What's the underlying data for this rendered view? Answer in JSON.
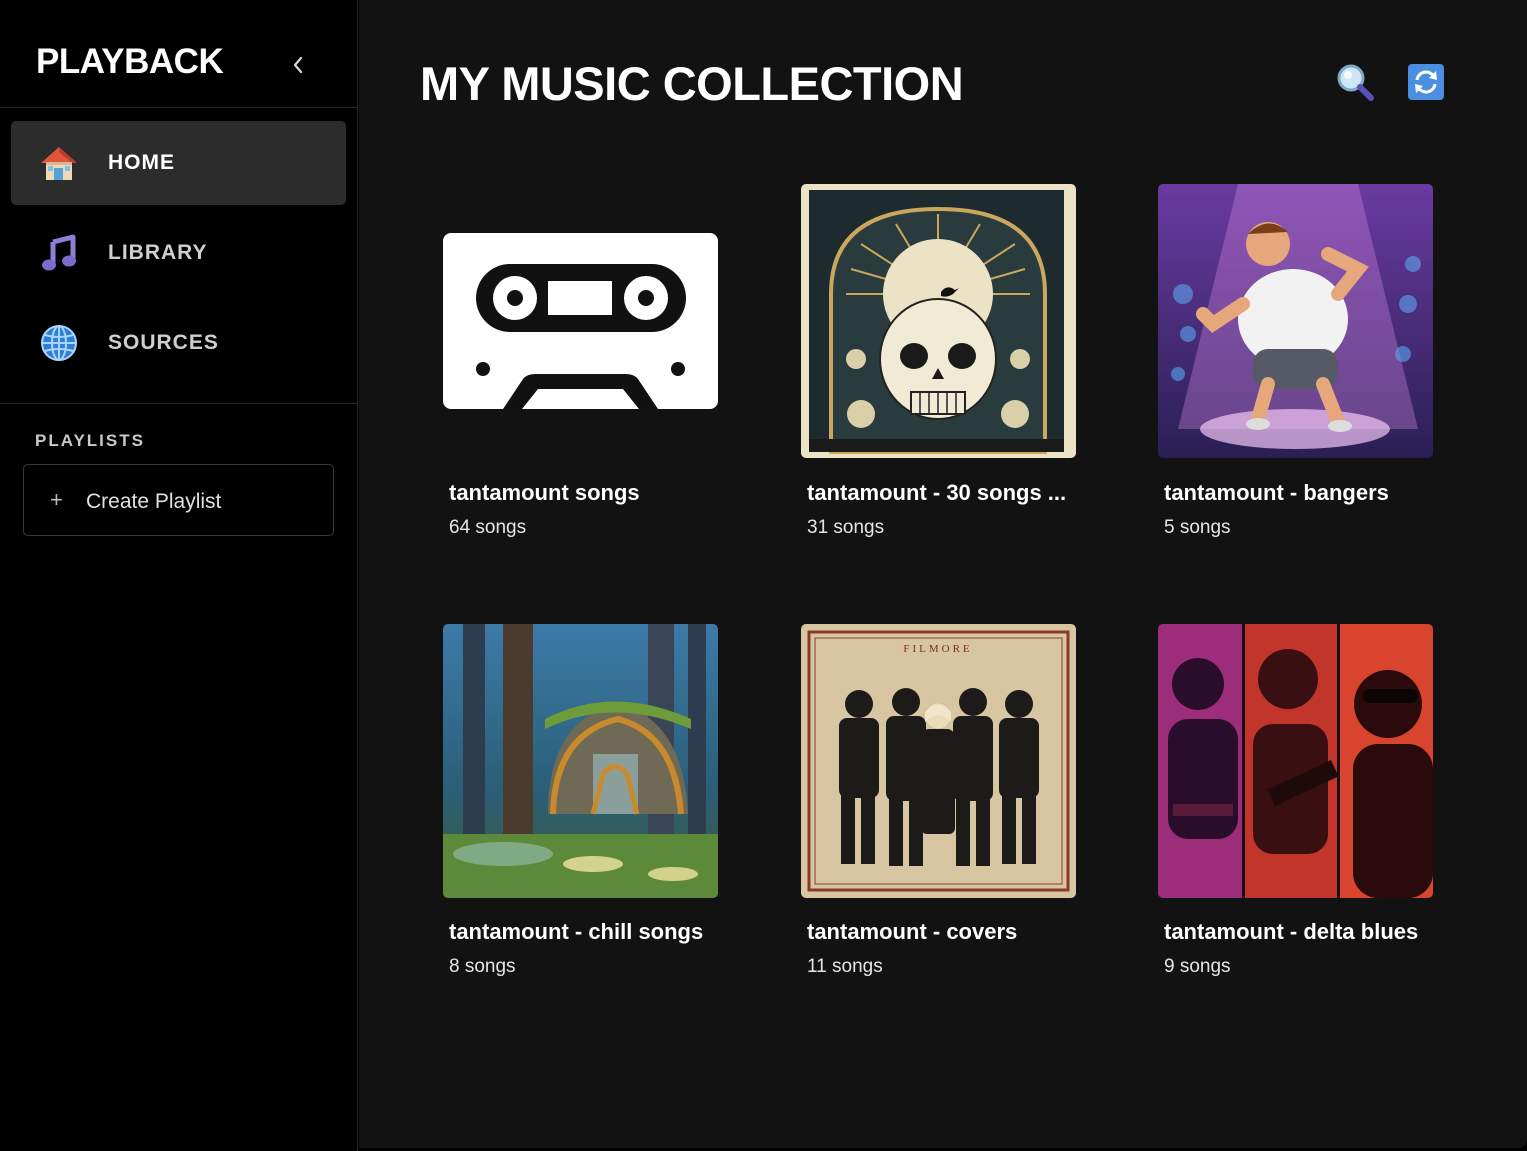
{
  "app": {
    "brand": "PLAYBACK",
    "collapse_icon": "chevron-left-icon"
  },
  "nav": [
    {
      "label": "HOME",
      "icon": "house-icon",
      "active": true
    },
    {
      "label": "LIBRARY",
      "icon": "music-note-icon",
      "active": false
    },
    {
      "label": "SOURCES",
      "icon": "globe-icon",
      "active": false
    }
  ],
  "playlists": {
    "section_title": "PLAYLISTS",
    "create_label": "Create Playlist",
    "create_icon": "plus-icon"
  },
  "header": {
    "title": "MY MUSIC COLLECTION",
    "search_icon": "magnifier-icon",
    "refresh_icon": "refresh-icon"
  },
  "collection": [
    {
      "title": "tantamount songs",
      "subtitle": "64 songs",
      "art": "cassette-tape-art"
    },
    {
      "title": "tantamount - 30 songs ...",
      "subtitle": "31 songs",
      "art": "skull-poster-art"
    },
    {
      "title": "tantamount - bangers",
      "subtitle": "5 songs",
      "art": "dancing-man-art"
    },
    {
      "title": "tantamount - chill songs",
      "subtitle": "8 songs",
      "art": "forest-house-art"
    },
    {
      "title": "tantamount - covers",
      "subtitle": "11 songs",
      "art": "band-photo-art",
      "art_text": "FILMORE"
    },
    {
      "title": "tantamount - delta blues",
      "subtitle": "9 songs",
      "art": "blues-musicians-art"
    }
  ],
  "colors": {
    "sidebar_bg": "#000000",
    "main_bg": "#121212",
    "active_nav_bg": "#2c2c2c",
    "text": "#ffffff"
  }
}
